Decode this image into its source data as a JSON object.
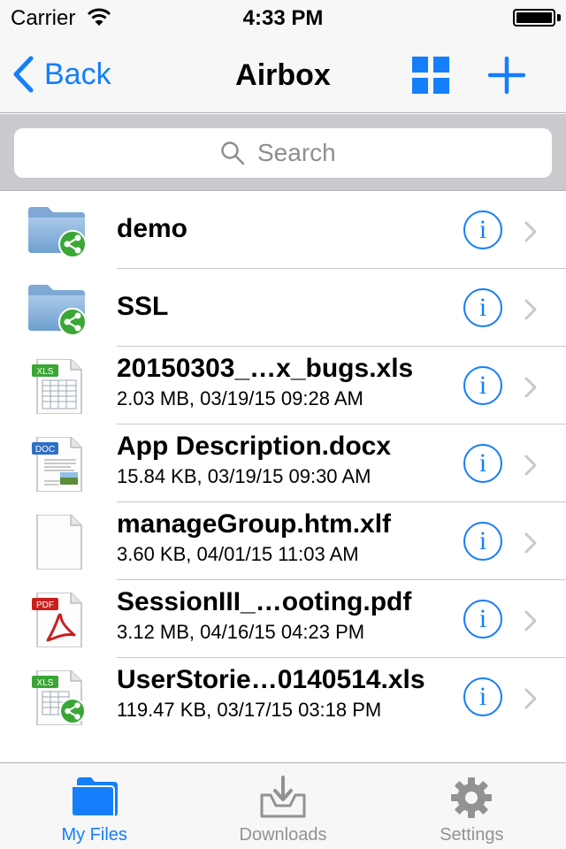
{
  "status_bar": {
    "carrier": "Carrier",
    "time": "4:33 PM"
  },
  "nav": {
    "back_label": "Back",
    "title": "Airbox"
  },
  "search": {
    "placeholder": "Search"
  },
  "files": [
    {
      "name": "demo",
      "meta": "",
      "type": "shared-folder"
    },
    {
      "name": "SSL",
      "meta": "",
      "type": "shared-folder"
    },
    {
      "name": "20150303_…x_bugs.xls",
      "meta": "2.03 MB, 03/19/15 09:28 AM",
      "type": "xls",
      "badge": "XLS"
    },
    {
      "name": "App Description.docx",
      "meta": "15.84 KB, 03/19/15 09:30 AM",
      "type": "doc",
      "badge": "DOC"
    },
    {
      "name": "manageGroup.htm.xlf",
      "meta": "3.60 KB, 04/01/15 11:03 AM",
      "type": "blank"
    },
    {
      "name": "SessionIII_…ooting.pdf",
      "meta": "3.12 MB, 04/16/15 04:23 PM",
      "type": "pdf",
      "badge": "PDF"
    },
    {
      "name": "UserStorie…0140514.xls",
      "meta": "119.47 KB, 03/17/15 03:18 PM",
      "type": "xls-shared",
      "badge": "XLS"
    }
  ],
  "info_glyph": "i",
  "tabs": [
    {
      "label": "My Files",
      "active": true,
      "icon": "folder-icon"
    },
    {
      "label": "Downloads",
      "active": false,
      "icon": "download-tray-icon"
    },
    {
      "label": "Settings",
      "active": false,
      "icon": "gear-icon"
    }
  ],
  "colors": {
    "accent": "#147efb",
    "inactive": "#929292",
    "share_green": "#3aa636",
    "pdf_red": "#c8201f"
  }
}
